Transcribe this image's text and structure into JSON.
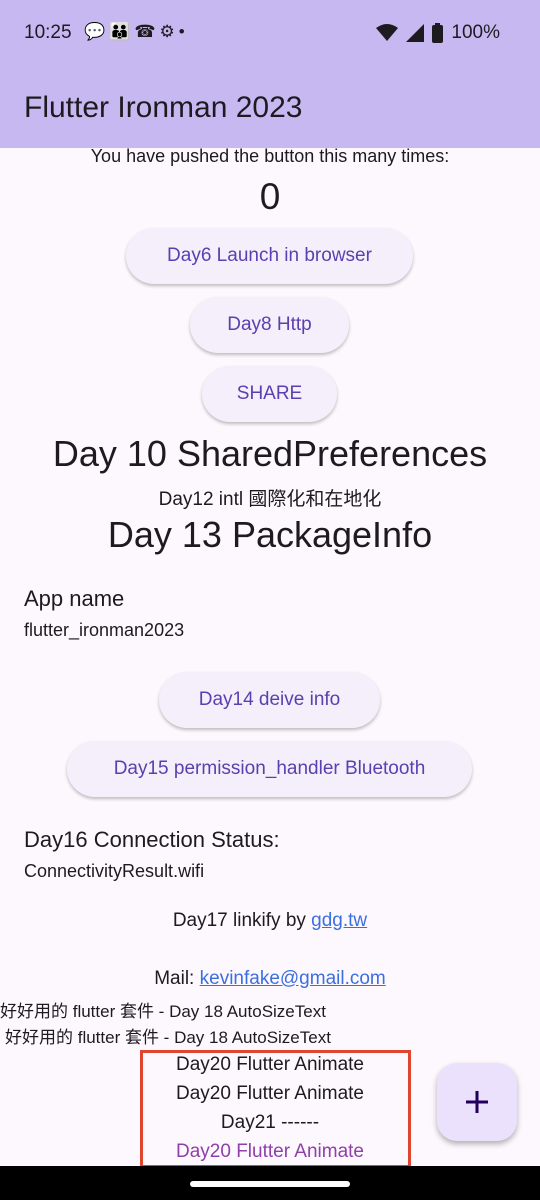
{
  "status": {
    "time": "10:25",
    "battery": "100%",
    "icons": [
      "chat-icon",
      "people-icon",
      "call-icon",
      "settings-icon",
      "dot-icon",
      "wifi-icon",
      "signal-icon",
      "battery-icon"
    ]
  },
  "appbar": {
    "title": "Flutter Ironman 2023"
  },
  "counter": {
    "label": "You have pushed the button this many times:",
    "value": "0"
  },
  "buttons": {
    "day6": "Day6 Launch in browser",
    "day8": "Day8 Http",
    "share": "SHARE",
    "day14": "Day14 deive info",
    "day15": "Day15 permission_handler Bluetooth"
  },
  "sections": {
    "day10": "Day 10 SharedPreferences",
    "day12": "Day12 intl 國際化和在地化",
    "day13": "Day 13 PackageInfo",
    "app_name_label": "App name",
    "app_name_value": "flutter_ironman2023",
    "day16_label": "Day16 Connection Status:",
    "day16_value": "ConnectivityResult.wifi",
    "day17_prefix": "Day17 linkify by ",
    "day17_link": "gdg.tw",
    "mail_prefix": "Mail: ",
    "mail_link": "kevinfake@gmail.com",
    "autosize1": "好好用的 flutter 套件 - Day 18 AutoSizeText",
    "autosize2": "好好用的 flutter 套件 - Day 18 AutoSizeText",
    "anim1": "Day20 Flutter Animate",
    "anim2": "Day20 Flutter Animate",
    "day21": "Day21 ------",
    "anim3": "Day20 Flutter Animate"
  },
  "fab": {
    "icon": "plus-icon"
  },
  "colors": {
    "appbar": "#c7b8f2",
    "button_text": "#5b3fb0",
    "link": "#3b6fe0",
    "highlight": "#e0452f",
    "anim3": "#8e3fa8"
  }
}
